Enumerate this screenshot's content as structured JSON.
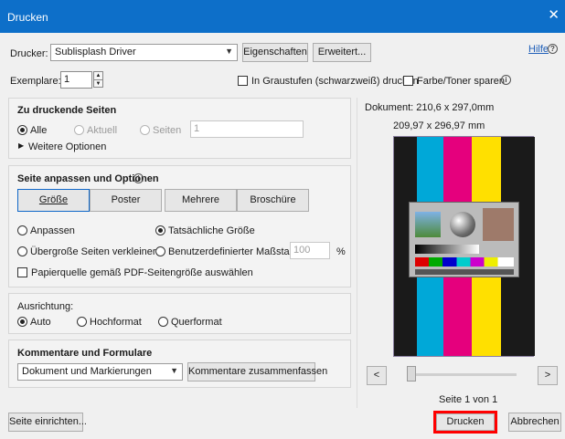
{
  "window": {
    "title": "Drucken",
    "close_glyph": "✕"
  },
  "header": {
    "printer_label": "Drucker:",
    "printer_value": "Sublisplash Driver",
    "properties_button": "Eigenschaften",
    "advanced_button": "Erweitert...",
    "help_link": "Hilfe",
    "copies_label": "Exemplare:",
    "copies_value": "1",
    "grayscale_label": "In Graustufen (schwarzweiß) drucken",
    "save_ink_label": "Farbe/Toner sparen"
  },
  "pages_to_print": {
    "title": "Zu druckende Seiten",
    "all": "Alle",
    "current": "Aktuell",
    "pages": "Seiten",
    "pages_value": "1",
    "more_options": "Weitere Optionen",
    "more_options_glyph": "▶"
  },
  "page_sizing": {
    "title": "Seite anpassen und Optionen",
    "tabs": [
      "Größe",
      "Poster",
      "Mehrere",
      "Broschüre"
    ],
    "fit": "Anpassen",
    "actual_size": "Tatsächliche Größe",
    "shrink": "Übergroße Seiten verkleinern",
    "custom_scale": "Benutzerdefinierter Maßstab:",
    "custom_scale_value": "100",
    "percent": "%",
    "paper_source": "Papierquelle gemäß PDF-Seitengröße auswählen"
  },
  "orientation": {
    "title": "Ausrichtung:",
    "auto": "Auto",
    "portrait": "Hochformat",
    "landscape": "Querformat"
  },
  "comments": {
    "title": "Kommentare und Formulare",
    "select_value": "Dokument und Markierungen",
    "summarize_button": "Kommentare zusammenfassen"
  },
  "preview": {
    "document_size": "Dokument: 210,6 x 297,0mm",
    "paper_size": "209,97 x 296,97 mm",
    "page_counter": "Seite 1 von 1",
    "prev_glyph": "<",
    "next_glyph": ">",
    "stripe_colors": [
      "#1a1a1a",
      "#00a8d8",
      "#e5007d",
      "#ffe000",
      "#1a1a1a"
    ]
  },
  "footer": {
    "page_setup_button": "Seite einrichten...",
    "print_button": "Drucken",
    "cancel_button": "Abbrechen"
  },
  "icons": {
    "info_glyph": "i",
    "help_glyph": "?",
    "dropdown_glyph": "▼",
    "spin_up": "▲",
    "spin_down": "▼"
  }
}
